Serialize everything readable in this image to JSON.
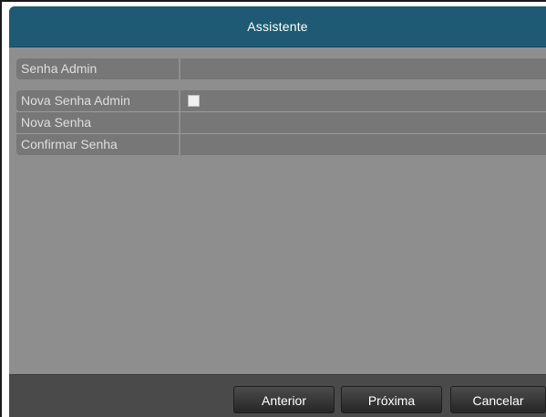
{
  "window": {
    "title": "Assistente"
  },
  "form": {
    "admin_password_label": "Senha Admin",
    "new_admin_password_label": "Nova Senha Admin",
    "new_admin_password_checked": false,
    "new_password_label": "Nova Senha",
    "confirm_password_label": "Confirmar Senha"
  },
  "footer": {
    "prev_label": "Anterior",
    "next_label": "Próxima",
    "cancel_label": "Cancelar"
  },
  "colors": {
    "titlebar": "#1e5a73",
    "panel": "#8e8e8e",
    "row": "#777777",
    "footer": "#4a4a4a"
  }
}
